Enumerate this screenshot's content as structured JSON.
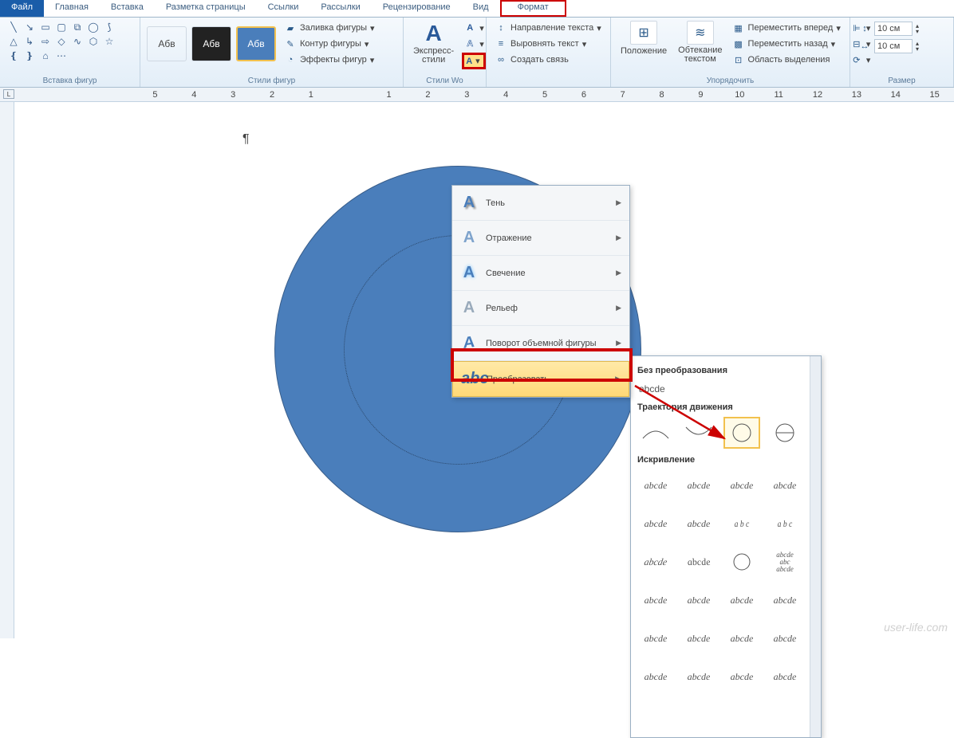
{
  "tabs": {
    "file": "Файл",
    "home": "Главная",
    "insert": "Вставка",
    "layout": "Разметка страницы",
    "refs": "Ссылки",
    "mail": "Рассылки",
    "review": "Рецензирование",
    "view": "Вид",
    "format": "Формат"
  },
  "ribbon": {
    "insert_shapes": "Вставка фигур",
    "shape_styles": "Стили фигур",
    "swatch_label": "Абв",
    "shape_fill": "Заливка фигуры",
    "shape_outline": "Контур фигуры",
    "shape_effects": "Эффекты фигур",
    "wordart_styles": "Стили Wo",
    "express_styles": "Экспресс-\nстили",
    "text_fill_icon": "A",
    "text_outline_icon": "A",
    "text_direction": "Направление текста",
    "align_text": "Выровнять текст",
    "create_link": "Создать связь",
    "position": "Положение",
    "wrap_text": "Обтекание\nтекстом",
    "bring_forward": "Переместить вперед",
    "send_backward": "Переместить назад",
    "selection_pane": "Область выделения",
    "arrange": "Упорядочить",
    "height": "10 см",
    "width": "10 см",
    "size": "Размер"
  },
  "dropdown": {
    "shadow": "Тень",
    "reflection": "Отражение",
    "glow": "Свечение",
    "bevel": "Рельеф",
    "rotation3d": "Поворот объемной фигуры",
    "transform": "Преобразовать"
  },
  "gallery": {
    "no_transform": "Без преобразования",
    "abcde": "abcde",
    "follow_path": "Траектория движения",
    "warp": "Искривление"
  },
  "ruler": [
    "5",
    "4",
    "3",
    "2",
    "1",
    "",
    "1",
    "2",
    "3",
    "4",
    "5",
    "6",
    "7",
    "8",
    "9",
    "10",
    "11",
    "12",
    "13",
    "14",
    "15"
  ],
  "watermark": "user-life.com"
}
